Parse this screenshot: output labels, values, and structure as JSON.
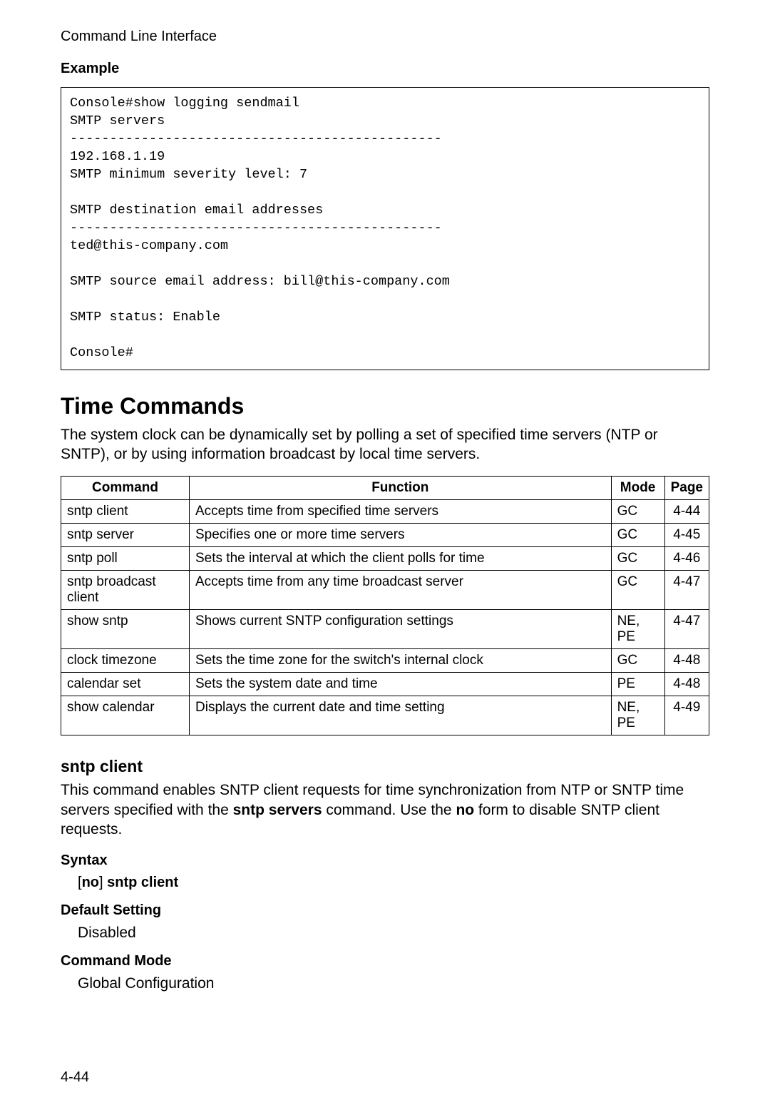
{
  "running_head": "Command Line Interface",
  "example_label": "Example",
  "code_block": "Console#show logging sendmail\nSMTP servers\n-----------------------------------------------\n192.168.1.19\nSMTP minimum severity level: 7\n\nSMTP destination email addresses\n-----------------------------------------------\nted@this-company.com\n\nSMTP source email address: bill@this-company.com\n\nSMTP status: Enable\n\nConsole#",
  "section_heading": "Time Commands",
  "section_intro": "The system clock can be dynamically set by polling a set of specified time servers (NTP or SNTP), or by using information broadcast by local time servers.",
  "table": {
    "headers": {
      "cmd": "Command",
      "fn": "Function",
      "mode": "Mode",
      "page": "Page"
    },
    "rows": [
      {
        "cmd": "sntp client",
        "fn": "Accepts time from specified time servers",
        "mode": "GC",
        "page": "4-44"
      },
      {
        "cmd": "sntp server",
        "fn": "Specifies one or more time servers",
        "mode": "GC",
        "page": "4-45"
      },
      {
        "cmd": "sntp poll",
        "fn": "Sets the interval at which the client polls for time",
        "mode": "GC",
        "page": "4-46"
      },
      {
        "cmd": "sntp broadcast client",
        "fn": "Accepts time from any time broadcast server",
        "mode": "GC",
        "page": "4-47"
      },
      {
        "cmd": "show sntp",
        "fn": "Shows current SNTP configuration settings",
        "mode": "NE, PE",
        "page": "4-47"
      },
      {
        "cmd": "clock timezone",
        "fn": "Sets the time zone for the switch's internal clock",
        "mode": "GC",
        "page": "4-48"
      },
      {
        "cmd": "calendar set",
        "fn": "Sets the system date and time",
        "mode": "PE",
        "page": "4-48"
      },
      {
        "cmd": "show calendar",
        "fn": "Displays the current date and time setting",
        "mode": "NE, PE",
        "page": "4-49"
      }
    ]
  },
  "subsection_heading": "sntp client",
  "subsection_para_pre": "This command enables SNTP client requests for time synchronization from NTP or SNTP time servers specified with the ",
  "subsection_bold1": "sntp servers",
  "subsection_mid": " command. Use the ",
  "subsection_bold2": "no",
  "subsection_tail": " form to disable SNTP client requests.",
  "syntax_label": "Syntax",
  "syntax_open": "[",
  "syntax_no": "no",
  "syntax_close": "]",
  "syntax_rest": " sntp client",
  "default_label": "Default Setting",
  "default_value": "Disabled",
  "mode_label": "Command Mode",
  "mode_value": "Global Configuration",
  "page_number": "4-44"
}
